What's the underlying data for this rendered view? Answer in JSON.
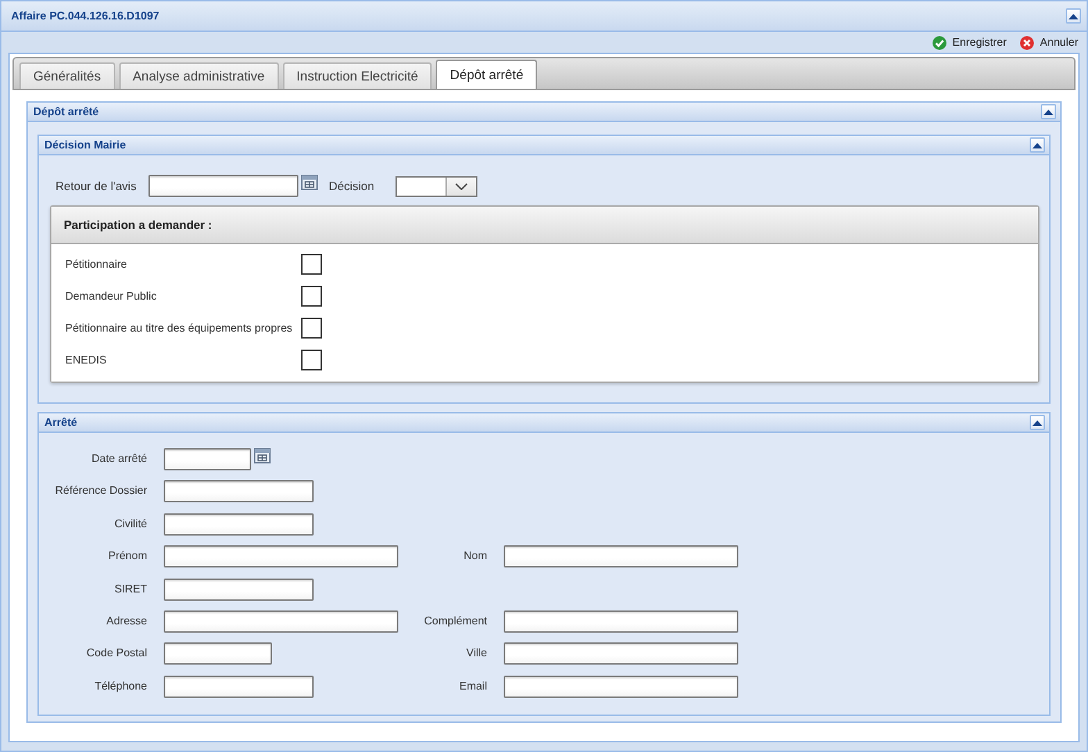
{
  "window": {
    "title": "Affaire PC.044.126.16.D1097"
  },
  "toolbar": [
    {
      "label": "Enregistrer",
      "kind": "save"
    },
    {
      "label": "Annuler",
      "kind": "cancel"
    }
  ],
  "tabs": [
    {
      "label": "Généralités",
      "selected": false
    },
    {
      "label": "Analyse administrative",
      "selected": false
    },
    {
      "label": "Instruction Electricité",
      "selected": false
    },
    {
      "label": "Dépôt arrêté",
      "selected": true
    }
  ],
  "panel": {
    "title": "Dépôt arrêté"
  },
  "decision": {
    "title": "Décision Mairie",
    "fields": [
      {
        "label": "Retour de l'avis",
        "kind": "date"
      },
      {
        "label": "Décision",
        "kind": "select"
      }
    ],
    "participation": {
      "title": "Participation a demander :",
      "items": [
        {
          "label": "Pétitionnaire",
          "checked": false
        },
        {
          "label": "Demandeur Public",
          "checked": false
        },
        {
          "label": "Pétitionnaire au titre des équipements propres",
          "checked": false
        },
        {
          "label": "ENEDIS",
          "checked": false
        }
      ]
    }
  },
  "arrete": {
    "title": "Arrêté",
    "rows": [
      [
        {
          "label": "Date arrêté",
          "kind": "date"
        }
      ],
      [
        {
          "label": "Référence Dossier",
          "kind": "medium"
        }
      ],
      [
        {
          "label": "Civilité",
          "kind": "medium"
        }
      ],
      [
        {
          "label": "Prénom",
          "kind": "long"
        },
        {
          "label": "Nom",
          "kind": "long"
        }
      ],
      [
        {
          "label": "SIRET",
          "kind": "medium"
        }
      ],
      [
        {
          "label": "Adresse",
          "kind": "long"
        },
        {
          "label": "Complément",
          "kind": "long"
        }
      ],
      [
        {
          "label": "Code Postal",
          "kind": "short"
        },
        {
          "label": "Ville",
          "kind": "long"
        }
      ],
      [
        {
          "label": "Téléphone",
          "kind": "medium"
        },
        {
          "label": "Email",
          "kind": "long"
        }
      ]
    ]
  }
}
